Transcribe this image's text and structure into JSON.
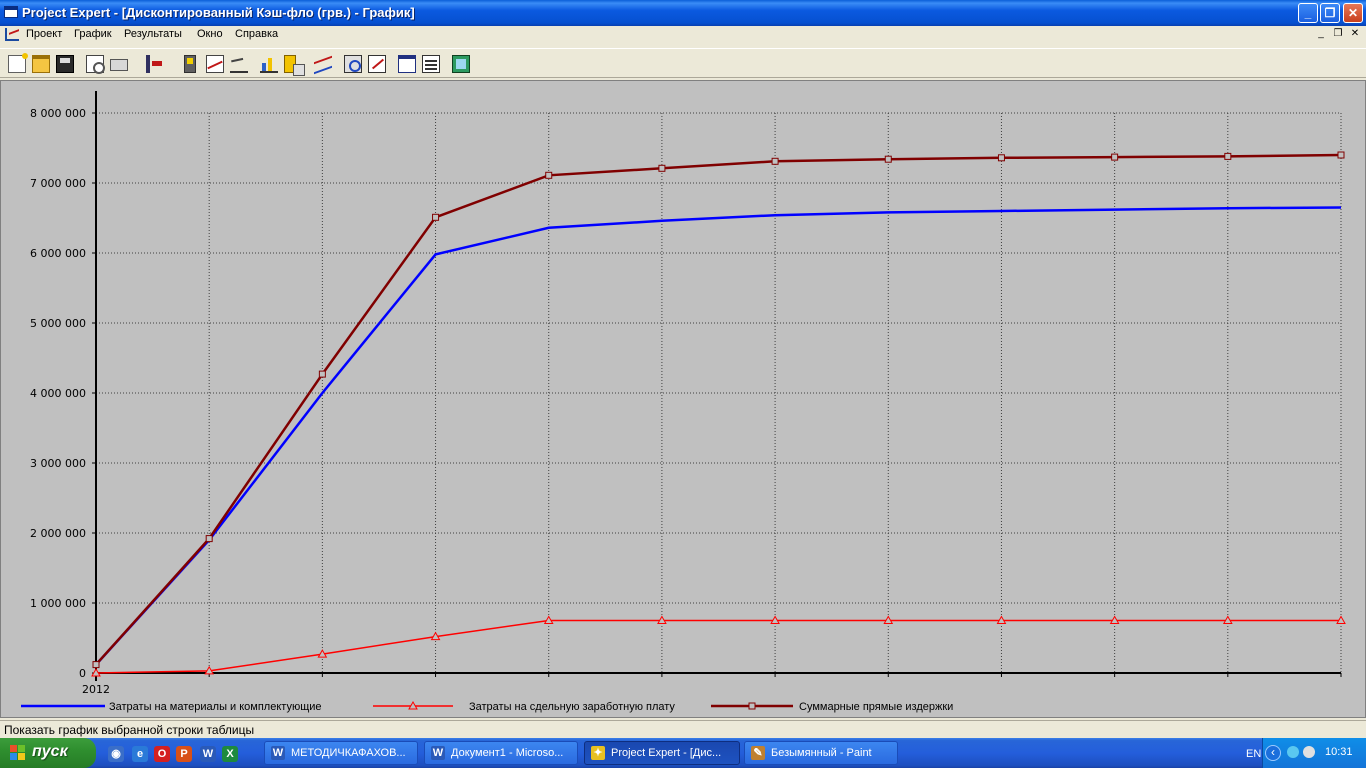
{
  "window": {
    "title": "Project Expert - [Дисконтированный Кэш-фло (грв.) - График]",
    "controls": {
      "minimize": "_",
      "maximize": "❐",
      "close": "✕"
    }
  },
  "menu": {
    "items": [
      "Проект",
      "График",
      "Результаты",
      "Окно",
      "Справка"
    ],
    "mdi_controls": {
      "minimize": "_",
      "restore": "❐",
      "close": "✕"
    }
  },
  "toolbar": {
    "icons": [
      "new-icon",
      "open-icon",
      "save-icon",
      "preview-icon",
      "print-icon",
      "exit-icon",
      "table-icon",
      "cashflow-icon",
      "balance-icon",
      "bar-chart-icon",
      "copy-icon",
      "line-chart-icon",
      "properties-icon",
      "edit-icon",
      "window-icon",
      "list-icon",
      "calculator-icon"
    ]
  },
  "chart_data": {
    "type": "line",
    "y_ticks": [
      "8 000 000",
      "7 000 000",
      "6 000 000",
      "5 000 000",
      "4 000 000",
      "3 000 000",
      "2 000 000",
      "1 000 000",
      "0"
    ],
    "ylim": [
      0,
      8000000
    ],
    "x_first_label": "2012",
    "x_points": 12,
    "grid": true,
    "series": [
      {
        "name": "Затраты на материалы и комплектующие",
        "color": "#0000ff",
        "marker": "none",
        "values": [
          120000,
          1900000,
          4000000,
          5980000,
          6360000,
          6460000,
          6540000,
          6580000,
          6600000,
          6620000,
          6640000,
          6650000
        ]
      },
      {
        "name": "Затраты на сдельную заработную плату",
        "color": "#ff0000",
        "marker": "triangle",
        "values": [
          0,
          30000,
          270000,
          520000,
          750000,
          750000,
          750000,
          750000,
          750000,
          750000,
          750000,
          750000
        ]
      },
      {
        "name": "Суммарные прямые издержки",
        "color": "#800000",
        "marker": "square",
        "values": [
          120000,
          1920000,
          4270000,
          6510000,
          7110000,
          7210000,
          7310000,
          7340000,
          7360000,
          7370000,
          7380000,
          7400000
        ]
      }
    ],
    "legend_position": "bottom"
  },
  "status": {
    "text": "Показать график выбранной строки таблицы"
  },
  "taskbar": {
    "start_label": "пуск",
    "quicklaunch": [
      {
        "icon": "explorer-icon",
        "glyph": "◉",
        "color": "#3a6ec8"
      },
      {
        "icon": "ie-icon",
        "glyph": "e",
        "color": "#2a7ad8"
      },
      {
        "icon": "opera-icon",
        "glyph": "O",
        "color": "#d42020"
      },
      {
        "icon": "powerpoint-icon",
        "glyph": "P",
        "color": "#d85018"
      },
      {
        "icon": "word-icon",
        "glyph": "W",
        "color": "#2a5ab8"
      },
      {
        "icon": "excel-icon",
        "glyph": "X",
        "color": "#1e8a3e"
      }
    ],
    "tasks": [
      {
        "label": "МЕТОДИЧКАФАХОВ...",
        "glyph": "W",
        "color": "#2a5ab8",
        "active": false
      },
      {
        "label": "Документ1 - Microso...",
        "glyph": "W",
        "color": "#2a5ab8",
        "active": false
      },
      {
        "label": "Project Expert - [Дис...",
        "glyph": "✦",
        "color": "#e8c020",
        "active": true
      },
      {
        "label": "Безымянный - Paint",
        "glyph": "✎",
        "color": "#c08030",
        "active": false
      }
    ],
    "language": "EN",
    "clock": "10:31"
  }
}
